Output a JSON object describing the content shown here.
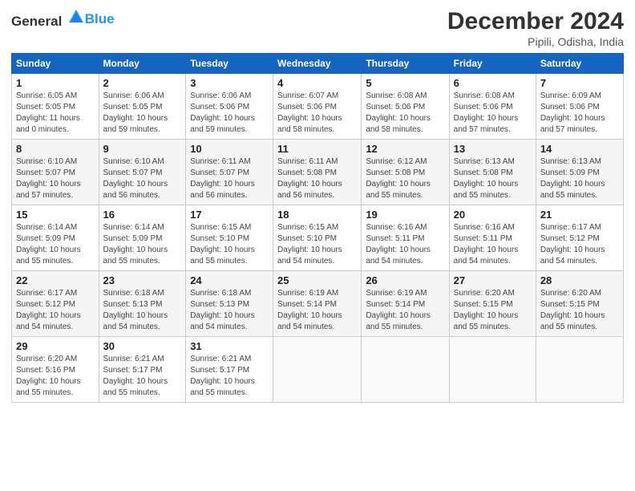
{
  "header": {
    "logo_general": "General",
    "logo_blue": "Blue",
    "month_title": "December 2024",
    "location": "Pipili, Odisha, India"
  },
  "weekdays": [
    "Sunday",
    "Monday",
    "Tuesday",
    "Wednesday",
    "Thursday",
    "Friday",
    "Saturday"
  ],
  "weeks": [
    [
      {
        "day": "1",
        "info": "Sunrise: 6:05 AM\nSunset: 5:05 PM\nDaylight: 11 hours\nand 0 minutes."
      },
      {
        "day": "2",
        "info": "Sunrise: 6:06 AM\nSunset: 5:05 PM\nDaylight: 10 hours\nand 59 minutes."
      },
      {
        "day": "3",
        "info": "Sunrise: 6:06 AM\nSunset: 5:06 PM\nDaylight: 10 hours\nand 59 minutes."
      },
      {
        "day": "4",
        "info": "Sunrise: 6:07 AM\nSunset: 5:06 PM\nDaylight: 10 hours\nand 58 minutes."
      },
      {
        "day": "5",
        "info": "Sunrise: 6:08 AM\nSunset: 5:06 PM\nDaylight: 10 hours\nand 58 minutes."
      },
      {
        "day": "6",
        "info": "Sunrise: 6:08 AM\nSunset: 5:06 PM\nDaylight: 10 hours\nand 57 minutes."
      },
      {
        "day": "7",
        "info": "Sunrise: 6:09 AM\nSunset: 5:06 PM\nDaylight: 10 hours\nand 57 minutes."
      }
    ],
    [
      {
        "day": "8",
        "info": "Sunrise: 6:10 AM\nSunset: 5:07 PM\nDaylight: 10 hours\nand 57 minutes."
      },
      {
        "day": "9",
        "info": "Sunrise: 6:10 AM\nSunset: 5:07 PM\nDaylight: 10 hours\nand 56 minutes."
      },
      {
        "day": "10",
        "info": "Sunrise: 6:11 AM\nSunset: 5:07 PM\nDaylight: 10 hours\nand 56 minutes."
      },
      {
        "day": "11",
        "info": "Sunrise: 6:11 AM\nSunset: 5:08 PM\nDaylight: 10 hours\nand 56 minutes."
      },
      {
        "day": "12",
        "info": "Sunrise: 6:12 AM\nSunset: 5:08 PM\nDaylight: 10 hours\nand 55 minutes."
      },
      {
        "day": "13",
        "info": "Sunrise: 6:13 AM\nSunset: 5:08 PM\nDaylight: 10 hours\nand 55 minutes."
      },
      {
        "day": "14",
        "info": "Sunrise: 6:13 AM\nSunset: 5:09 PM\nDaylight: 10 hours\nand 55 minutes."
      }
    ],
    [
      {
        "day": "15",
        "info": "Sunrise: 6:14 AM\nSunset: 5:09 PM\nDaylight: 10 hours\nand 55 minutes."
      },
      {
        "day": "16",
        "info": "Sunrise: 6:14 AM\nSunset: 5:09 PM\nDaylight: 10 hours\nand 55 minutes."
      },
      {
        "day": "17",
        "info": "Sunrise: 6:15 AM\nSunset: 5:10 PM\nDaylight: 10 hours\nand 55 minutes."
      },
      {
        "day": "18",
        "info": "Sunrise: 6:15 AM\nSunset: 5:10 PM\nDaylight: 10 hours\nand 54 minutes."
      },
      {
        "day": "19",
        "info": "Sunrise: 6:16 AM\nSunset: 5:11 PM\nDaylight: 10 hours\nand 54 minutes."
      },
      {
        "day": "20",
        "info": "Sunrise: 6:16 AM\nSunset: 5:11 PM\nDaylight: 10 hours\nand 54 minutes."
      },
      {
        "day": "21",
        "info": "Sunrise: 6:17 AM\nSunset: 5:12 PM\nDaylight: 10 hours\nand 54 minutes."
      }
    ],
    [
      {
        "day": "22",
        "info": "Sunrise: 6:17 AM\nSunset: 5:12 PM\nDaylight: 10 hours\nand 54 minutes."
      },
      {
        "day": "23",
        "info": "Sunrise: 6:18 AM\nSunset: 5:13 PM\nDaylight: 10 hours\nand 54 minutes."
      },
      {
        "day": "24",
        "info": "Sunrise: 6:18 AM\nSunset: 5:13 PM\nDaylight: 10 hours\nand 54 minutes."
      },
      {
        "day": "25",
        "info": "Sunrise: 6:19 AM\nSunset: 5:14 PM\nDaylight: 10 hours\nand 54 minutes."
      },
      {
        "day": "26",
        "info": "Sunrise: 6:19 AM\nSunset: 5:14 PM\nDaylight: 10 hours\nand 55 minutes."
      },
      {
        "day": "27",
        "info": "Sunrise: 6:20 AM\nSunset: 5:15 PM\nDaylight: 10 hours\nand 55 minutes."
      },
      {
        "day": "28",
        "info": "Sunrise: 6:20 AM\nSunset: 5:15 PM\nDaylight: 10 hours\nand 55 minutes."
      }
    ],
    [
      {
        "day": "29",
        "info": "Sunrise: 6:20 AM\nSunset: 5:16 PM\nDaylight: 10 hours\nand 55 minutes."
      },
      {
        "day": "30",
        "info": "Sunrise: 6:21 AM\nSunset: 5:17 PM\nDaylight: 10 hours\nand 55 minutes."
      },
      {
        "day": "31",
        "info": "Sunrise: 6:21 AM\nSunset: 5:17 PM\nDaylight: 10 hours\nand 55 minutes."
      },
      null,
      null,
      null,
      null
    ]
  ]
}
